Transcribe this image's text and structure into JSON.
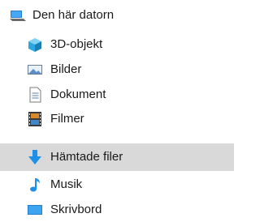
{
  "tree": {
    "root": {
      "label": "Den här datorn",
      "icon": "computer-icon"
    },
    "items": [
      {
        "label": "3D-objekt",
        "icon": "cube-3d-icon"
      },
      {
        "label": "Bilder",
        "icon": "pictures-icon"
      },
      {
        "label": "Dokument",
        "icon": "document-icon"
      },
      {
        "label": "Filmer",
        "icon": "film-icon"
      },
      {
        "label": "Hämtade filer",
        "icon": "download-arrow-icon",
        "selected": true
      },
      {
        "label": "Musik",
        "icon": "music-note-icon"
      },
      {
        "label": "Skrivbord",
        "icon": "desktop-icon"
      }
    ]
  },
  "colors": {
    "selected_bg": "#d9d9d9",
    "blue": "#1e90e8",
    "text": "#1a1a1a"
  }
}
